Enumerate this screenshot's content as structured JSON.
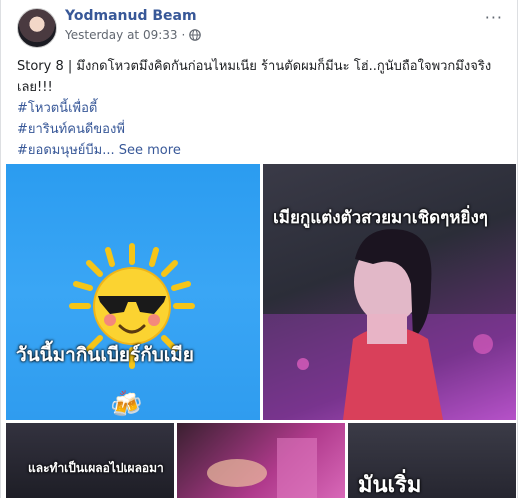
{
  "post": {
    "author": "Yodmanud Beam",
    "timestamp": "Yesterday at 09:33",
    "separator": "·",
    "privacy_icon": "globe-icon",
    "more_icon": "more-options-icon",
    "more_label": "···",
    "text_line1": "Story 8 | มึงกดโหวตมึงคิดกันก่อนไหมเนีย ร้านตัดผมก็มีนะ โฮ่..กูนับถือใจพวกมึงจริง",
    "text_line2": "เลย!!!",
    "hashtags": [
      "#โหวตนี้เพื่อตี้",
      "#ยารินท์คนดีของพี่"
    ],
    "hashtag_last": "#ยอดมนุษย์บีม...",
    "see_more": "See more"
  },
  "photos": {
    "photo1_caption": "วันนี้มากินเบียร์กับเมีย",
    "photo1_emoji": "🍻",
    "photo2_caption": "เมียกูแต่งตัวสวยมาเชิดๆหยิ่งๆ",
    "photo3_caption": "และทำเป็นเผลอไปเผลอมา",
    "photo5_caption": "มันเริ่ม"
  },
  "colors": {
    "link": "#385898",
    "photo1_bg": "#2b9cf0"
  }
}
